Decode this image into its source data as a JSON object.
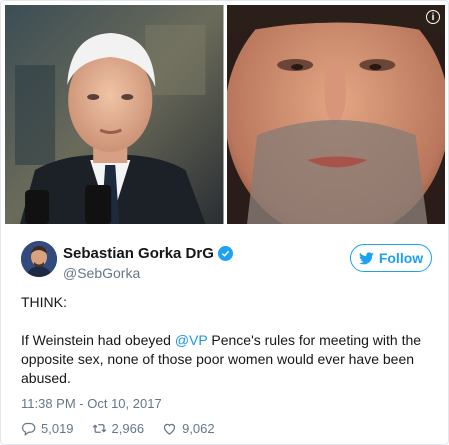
{
  "tweet": {
    "author": {
      "display_name": "Sebastian Gorka DrG",
      "handle": "@SebGorka"
    },
    "follow_label": "Follow",
    "text_line1": "THINK:",
    "text_before_mention": "If Weinstein had obeyed ",
    "mention": "@VP",
    "text_after_mention": " Pence's rules for meeting with the opposite sex, none of those poor women would ever have been abused.",
    "timestamp": "11:38 PM - Oct 10, 2017",
    "stats": {
      "replies": "5,019",
      "retweets": "2,966",
      "likes": "9,062"
    },
    "media_info_glyph": "i"
  },
  "colors": {
    "accent": "#1da1f2",
    "mention": "#1b95e0",
    "muted": "#657786"
  },
  "icons": {
    "media_info": "info-icon",
    "verified": "verified-badge-icon",
    "follow": "twitter-bird-icon",
    "reply": "reply-icon",
    "retweet": "retweet-icon",
    "like": "heart-icon"
  }
}
